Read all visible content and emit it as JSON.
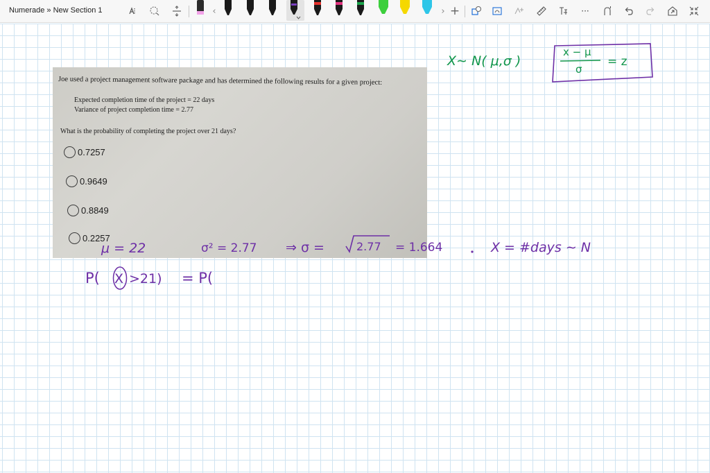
{
  "app": {
    "breadcrumb": "Numerade » New Section 1"
  },
  "toolbar": {
    "icons": [
      "lasso-select-icon",
      "add-space-icon",
      "insert-space-icon",
      "eraser-icon",
      "chevron-left-icon",
      "chevron-right-icon",
      "add-pen-icon",
      "shapes-icon",
      "ink-to-shape-icon",
      "ink-to-math-icon",
      "ruler-icon",
      "ink-replay-icon",
      "more-icon",
      "touch-draw-icon",
      "undo-icon",
      "redo-icon",
      "share-icon",
      "collapse-icon"
    ],
    "more_glyph": "···",
    "chevron_left": "‹",
    "chevron_right": "›",
    "add_glyph": "+",
    "pens": [
      {
        "name": "pen-black",
        "color": "#1a1a1a"
      },
      {
        "name": "pen-black-2",
        "color": "#1a1a1a"
      },
      {
        "name": "pen-black-3",
        "color": "#1a1a1a"
      },
      {
        "name": "pen-red",
        "color": "#e5322d"
      },
      {
        "name": "pen-purple-selected",
        "color": "#7a3fbf"
      },
      {
        "name": "pen-pink",
        "color": "#e0327e"
      },
      {
        "name": "pen-blue",
        "color": "#1e6fd9"
      },
      {
        "name": "pen-green",
        "color": "#1aa24a"
      },
      {
        "name": "highlighter-yellow",
        "color": "#f5d800"
      },
      {
        "name": "highlighter-green",
        "color": "#3ccf3c"
      },
      {
        "name": "highlighter-cyan",
        "color": "#2ec6e8"
      }
    ],
    "first_highlighter_color": "#f2a1e8"
  },
  "question": {
    "intro": "Joe used a project management software package and has determined the following results for a given project:",
    "given1": "Expected completion time of the project = 22 days",
    "given2": "Variance of project completion time = 2.77",
    "prompt": "What is the probability of completing the project over 21 days?",
    "options": [
      "0.7257",
      "0.9649",
      "0.8849",
      "0.2257"
    ]
  },
  "ink": {
    "colors": {
      "green": "#10954a",
      "purple": "#6d2fa6"
    },
    "green_dist": "X∼ N( μ,σ )",
    "box_numerator": "x − μ",
    "box_denominator": "σ",
    "box_rhs": "= z",
    "mu_line": "μ = 22",
    "sigma_sq": "σ² = 2.77",
    "implies": "⇒ σ =",
    "sqrt_arg": "2.77",
    "sqrt_result": "= 1.664",
    "x_def": "X = #days ∼ N",
    "prob_lhs": "P(",
    "prob_var": "X",
    "prob_cond": ">21)",
    "prob_rhs": "= P("
  }
}
